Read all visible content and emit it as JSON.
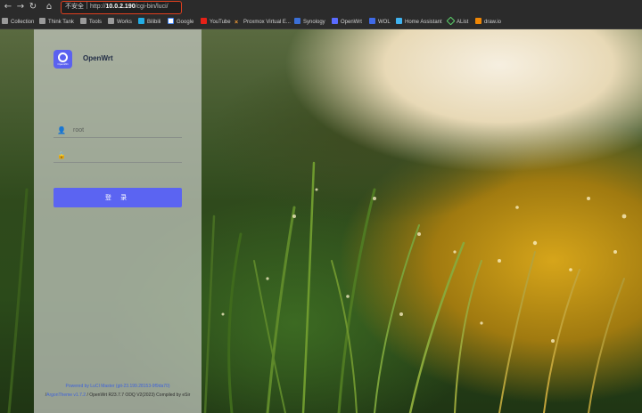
{
  "browser": {
    "nav": {
      "back": "←",
      "forward": "→",
      "reload": "↻",
      "home": "⌂"
    },
    "address": {
      "security_label": "不安全",
      "scheme": "http://",
      "host": "10.0.2.190",
      "path": "/cgi-bin/luci/"
    },
    "bookmarks": [
      {
        "label": "Collection",
        "icon": "folder-icon"
      },
      {
        "label": "Think Tank",
        "icon": "folder-icon"
      },
      {
        "label": "Tools",
        "icon": "folder-icon"
      },
      {
        "label": "Works",
        "icon": "folder-icon"
      },
      {
        "label": "Bilibili",
        "icon": "bilibili-icon"
      },
      {
        "label": "Google",
        "icon": "google-icon"
      },
      {
        "label": "YouTube",
        "icon": "youtube-icon"
      },
      {
        "label": "Proxmox Virtual E...",
        "icon": "proxmox-icon"
      },
      {
        "label": "Synology",
        "icon": "synology-icon"
      },
      {
        "label": "OpenWrt",
        "icon": "openwrt-icon"
      },
      {
        "label": "WOL",
        "icon": "wol-icon"
      },
      {
        "label": "Home Assistant",
        "icon": "home-assistant-icon"
      },
      {
        "label": "AList",
        "icon": "alist-icon"
      },
      {
        "label": "draw.io",
        "icon": "drawio-icon"
      }
    ]
  },
  "login": {
    "brand": "OpenWrt",
    "logo_text": "OpenWrt",
    "username_placeholder": "root",
    "password_placeholder": "",
    "submit_label": "登 录"
  },
  "footer": {
    "powered_by": "Powered by LuCI Master (git-23.199.28153-9f9da70)",
    "theme_link": "ArgonTheme v1.7.2",
    "prefix": "/",
    "build": " / OpenWrt R23.7.7 ODQ V2(2023) Compiled by eSir"
  },
  "colors": {
    "accent": "#5b64f2",
    "address_border": "#e0401f",
    "panel": "#c6cac4"
  }
}
